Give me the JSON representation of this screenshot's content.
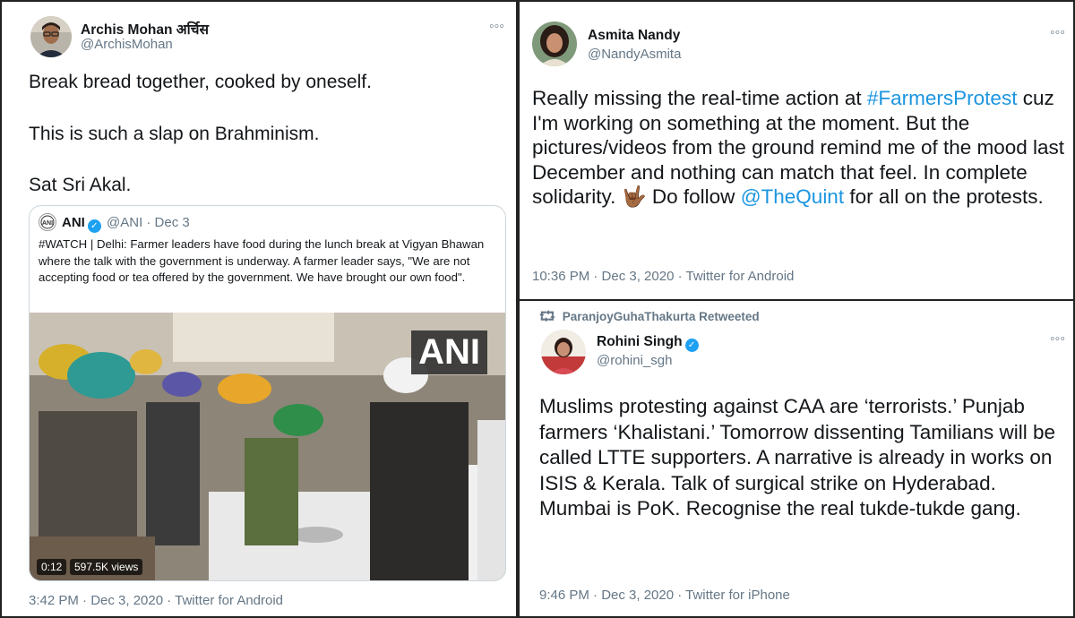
{
  "tweets": [
    {
      "name": "Archis Mohan अर्चिस",
      "handle": "@ArchisMohan",
      "lines": [
        "Break bread together, cooked by oneself.",
        "This is such a slap on Brahminism.",
        "Sat Sri Akal."
      ],
      "quoted": {
        "name": "ANI",
        "handle_date": "@ANI · Dec 3",
        "text": "#WATCH | Delhi: Farmer leaders have food during the lunch break at Vigyan Bhawan where the talk with the government is underway. A farmer leader says, \"We are not accepting food or tea offered by the government. We have brought our own food\".",
        "media_logo": "ANI",
        "video_time": "0:12",
        "video_views": "597.5K views"
      },
      "meta": "3:42 PM · Dec 3, 2020 · Twitter for Android"
    },
    {
      "name": "Asmita Nandy",
      "handle": "@NandyAsmita",
      "text_parts": {
        "a": "Really missing the real-time action at ",
        "hashtag": "#FarmersProtest",
        "b": " cuz I'm working on something at the moment. But the pictures/videos from the ground remind me of the mood last December and nothing can match that feel. In complete solidarity. ",
        "emoji": "🤟🏾",
        "c": " Do follow ",
        "mention": "@TheQuint",
        "d": " for all on the protests."
      },
      "meta": "10:36 PM · Dec 3, 2020 · Twitter for Android"
    },
    {
      "retweeted_by": "ParanjoyGuhaThakurta Retweeted",
      "name": "Rohini Singh",
      "handle": "@rohini_sgh",
      "text": "Muslims protesting against CAA are ‘terrorists.’ Punjab farmers ‘Khalistani.’ Tomorrow dissenting Tamilians will be called LTTE supporters. A narrative is already in works on ISIS & Kerala. Talk of surgical strike on Hyderabad. Mumbai is PoK. Recognise the real tukde-tukde gang.",
      "meta": "9:46 PM · Dec 3, 2020 · Twitter for iPhone"
    }
  ],
  "more_label": "◦◦◦",
  "colors": {
    "link": "#1b95e0",
    "secondary": "#657786",
    "verified": "#1da1f2"
  },
  "icons": {
    "more": "more-icon",
    "retweet": "retweet-icon",
    "verified": "verified-icon",
    "play": "video-icon"
  }
}
